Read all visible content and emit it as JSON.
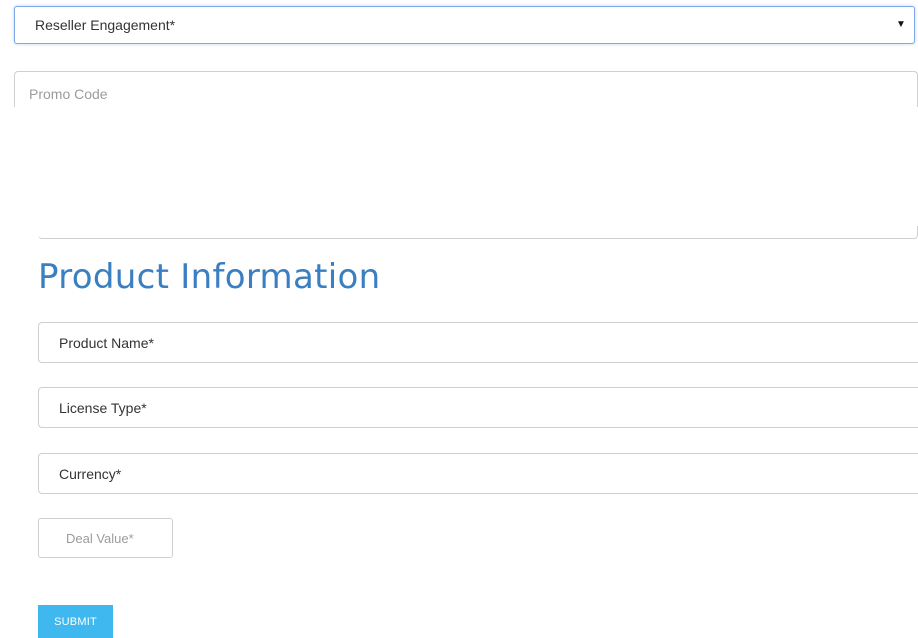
{
  "form": {
    "reseller_select": {
      "selected": "Reseller Engagement*",
      "caret_icon": "▼"
    },
    "promo_code": {
      "placeholder": "Promo Code"
    }
  },
  "product_section": {
    "title": "Product Information",
    "fields": {
      "product_name": "Product Name*",
      "license_type": "License Type*",
      "currency": "Currency*",
      "deal_value_placeholder": "Deal Value*"
    }
  },
  "actions": {
    "submit_label": "SUBMIT"
  },
  "colors": {
    "title": "#3a7fc1",
    "submit_bg": "#3fb8f0",
    "focus_border": "#7ea8e8",
    "field_border": "#cfcfcf"
  }
}
